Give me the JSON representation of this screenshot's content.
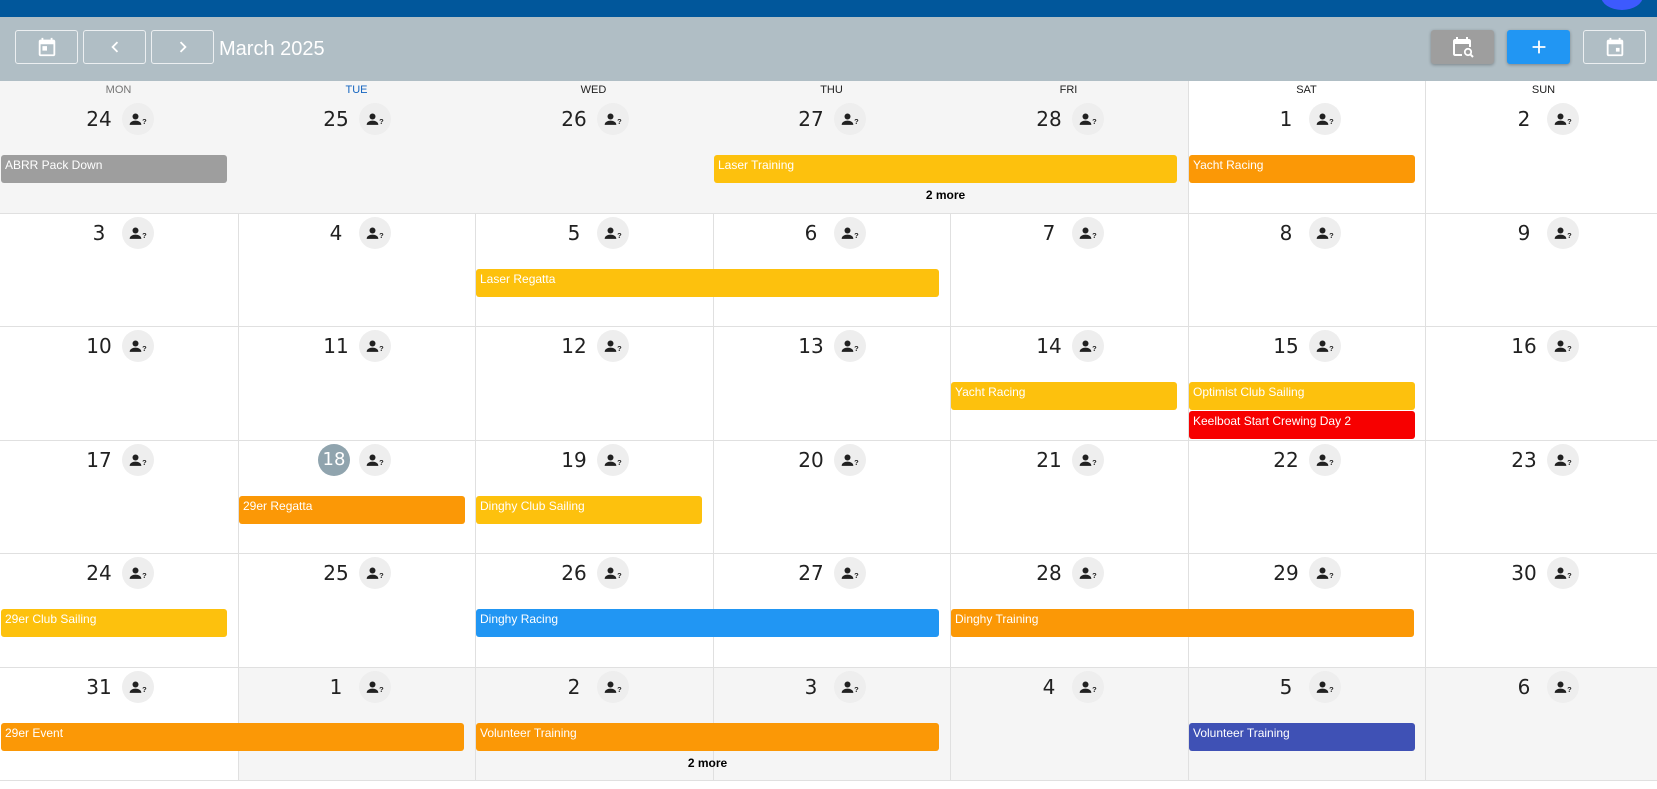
{
  "header": {
    "month_title": "March 2025",
    "buttons": {
      "today_icon": "calendar-today-icon",
      "prev_icon": "chevron-left-icon",
      "next_icon": "chevron-right-icon",
      "search_icon": "calendar-search-icon",
      "add_icon": "plus-icon",
      "view_icon": "calendar-view-icon"
    }
  },
  "colors": {
    "top_bar": "#01579b",
    "toolbar": "#b0bec5",
    "yellow": "#fdc10d",
    "orange": "#fb9806",
    "red": "#f70000",
    "blue": "#2196f3",
    "indigo": "#3f51b5",
    "grey": "#9e9e9e"
  },
  "weekdays": [
    "MON",
    "TUE",
    "WED",
    "THU",
    "FRI",
    "SAT",
    "SUN"
  ],
  "attendance_icon": "person-question-icon",
  "weeks": [
    {
      "days": [
        "24",
        "25",
        "26",
        "27",
        "28",
        "1",
        "2"
      ]
    },
    {
      "days": [
        "3",
        "4",
        "5",
        "6",
        "7",
        "8",
        "9"
      ]
    },
    {
      "days": [
        "10",
        "11",
        "12",
        "13",
        "14",
        "15",
        "16"
      ]
    },
    {
      "days": [
        "17",
        "18",
        "19",
        "20",
        "21",
        "22",
        "23"
      ]
    },
    {
      "days": [
        "24",
        "25",
        "26",
        "27",
        "28",
        "29",
        "30"
      ]
    },
    {
      "days": [
        "31",
        "1",
        "2",
        "3",
        "4",
        "5",
        "6"
      ]
    }
  ],
  "today": {
    "week": 3,
    "day": 1
  },
  "events": [
    {
      "title": "ABRR Pack Down",
      "week": 0,
      "start": 0,
      "span": 1,
      "lane": 0,
      "color": "grey"
    },
    {
      "title": "Laser Training",
      "week": 0,
      "start": 3,
      "span": 2,
      "lane": 0,
      "color": "yellow"
    },
    {
      "title": "Yacht Racing",
      "week": 0,
      "start": 5,
      "span": 1,
      "lane": 0,
      "color": "orange"
    },
    {
      "title": "Laser Regatta",
      "week": 1,
      "start": 2,
      "span": 2,
      "lane": 0,
      "color": "yellow"
    },
    {
      "title": "Yacht Racing",
      "week": 2,
      "start": 4,
      "span": 1,
      "lane": 0,
      "color": "yellow"
    },
    {
      "title": "Optimist Club Sailing",
      "week": 2,
      "start": 5,
      "span": 1,
      "lane": 0,
      "color": "yellow"
    },
    {
      "title": "Keelboat Start Crewing Day 2",
      "week": 2,
      "start": 5,
      "span": 1,
      "lane": 1,
      "color": "red"
    },
    {
      "title": "29er Regatta",
      "week": 3,
      "start": 1,
      "span": 1,
      "lane": 0,
      "color": "orange"
    },
    {
      "title": "Dinghy Club Sailing",
      "week": 3,
      "start": 2,
      "span": 1,
      "lane": 0,
      "color": "yellow"
    },
    {
      "title": "29er Club Sailing",
      "week": 4,
      "start": 0,
      "span": 1,
      "lane": 0,
      "color": "yellow"
    },
    {
      "title": "Dinghy Racing",
      "week": 4,
      "start": 2,
      "span": 2,
      "lane": 0,
      "color": "blue"
    },
    {
      "title": "Dinghy Training",
      "week": 4,
      "start": 4,
      "span": 2,
      "lane": 0,
      "color": "orange"
    },
    {
      "title": "29er Event",
      "week": 5,
      "start": 0,
      "span": 2,
      "lane": 0,
      "color": "orange"
    },
    {
      "title": "Volunteer Training",
      "week": 5,
      "start": 2,
      "span": 2,
      "lane": 0,
      "color": "orange"
    },
    {
      "title": "Volunteer Training",
      "week": 5,
      "start": 5,
      "span": 1,
      "lane": 0,
      "color": "indigo"
    }
  ],
  "more_links": [
    {
      "label": "2 more",
      "week": 0,
      "start": 3,
      "span": 2
    },
    {
      "label": "2 more",
      "week": 5,
      "start": 2,
      "span": 2
    }
  ]
}
